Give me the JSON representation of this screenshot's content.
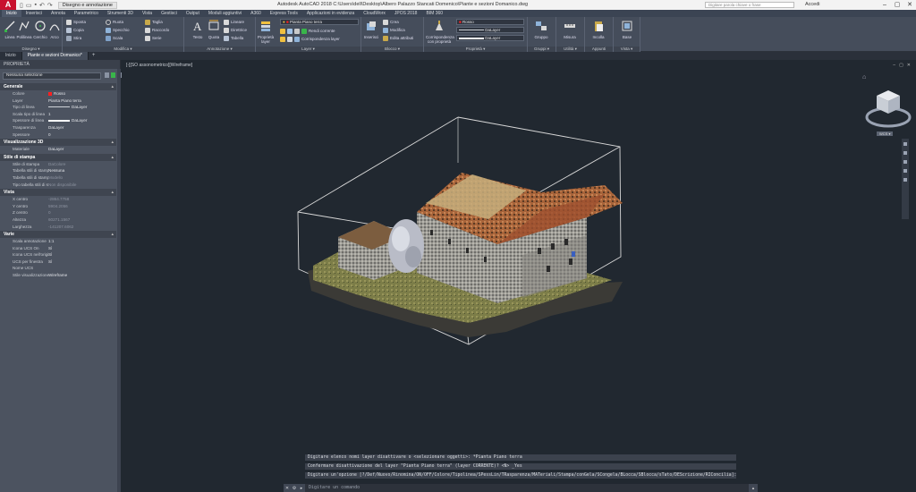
{
  "titlebar": {
    "app_logo": "A",
    "workspace": "Disegno e annotazione",
    "title": "Autodesk AutoCAD 2018    C:\\Users\\dell\\Desktop\\Albero Palazzo Stancati Domenico\\Piante e sezioni Domanico.dwg",
    "search_placeholder": "Digitare parola chiave o frase",
    "user": "Accedi"
  },
  "ribbon_tabs": [
    "Inizio",
    "Inserisci",
    "Annota",
    "Parametrico",
    "Strumenti 3D",
    "Vista",
    "Gestisci",
    "Output",
    "Moduli aggiuntivi",
    "A360",
    "Express Tools",
    "Applicazioni in evidenza",
    "CloudWorx",
    "JPOS 2018",
    "BIM 360"
  ],
  "panels": {
    "disegno": {
      "label": "Disegno ▾",
      "buttons": [
        "Linea",
        "Polilinea",
        "Cerchio",
        "Arco"
      ]
    },
    "modifica": {
      "label": "Modifica ▾",
      "rows": [
        "Sposta",
        "Ruota",
        "Taglia",
        "Copia",
        "Specchio",
        "Raccordo",
        "Stira",
        "Scala",
        "Serie"
      ]
    },
    "annotazione": {
      "label": "Annotazione ▾",
      "buttons": [
        "Testo",
        "Quota"
      ],
      "rows": [
        "Lineare",
        "Direttrice",
        "Tabella"
      ]
    },
    "layer": {
      "label": "Layer ▾",
      "button": "Proprietà layer",
      "current": "Pianta Piano terra",
      "rows": [
        "Rendi corrente",
        "Corrispondenza layer"
      ]
    },
    "blocco": {
      "label": "Blocco ▾",
      "button": "Inserisci",
      "rows": [
        "Crea",
        "Modifica",
        "Edita attributi"
      ]
    },
    "proprieta": {
      "label": "Proprietà ▾",
      "button": "Corrispondenza con proprietà",
      "color": "Rosso",
      "linetype": "DaLayer",
      "lineweight": "DaLayer"
    },
    "gruppi": {
      "label": "Gruppi ▾",
      "button": "Gruppo"
    },
    "utilita": {
      "label": "Utilità ▾",
      "button": "Misura"
    },
    "appunti": {
      "label": "Appunti",
      "button": "Incolla"
    },
    "vista": {
      "label": "Vista ▾",
      "button": "Base"
    }
  },
  "doc_tabs": [
    "Inizio",
    "Piante e sezioni Domanico*"
  ],
  "properties": {
    "title": "PROPRIETÀ",
    "selection": "Nessuna selezione",
    "groups": [
      {
        "name": "Generale",
        "rows": [
          {
            "key": "Colore",
            "value": "Rosso",
            "swatch": "#ff2020"
          },
          {
            "key": "Layer",
            "value": "Pianta Piano terra"
          },
          {
            "key": "Tipo di linea",
            "value": "DaLayer",
            "line": true
          },
          {
            "key": "Scala tipo di linea",
            "value": "1"
          },
          {
            "key": "Spessore di linea",
            "value": "DaLayer",
            "line": true,
            "thick": true
          },
          {
            "key": "Trasparenza",
            "value": "DaLayer"
          },
          {
            "key": "Spessore",
            "value": "0"
          }
        ]
      },
      {
        "name": "Visualizzazione 3D",
        "rows": [
          {
            "key": "Materiale",
            "value": "DaLayer"
          }
        ]
      },
      {
        "name": "Stile di stampa",
        "rows": [
          {
            "key": "Stile di stampa",
            "value": "DaColore",
            "dim": true
          },
          {
            "key": "Tabella stili di stampa",
            "value": "Nessuna"
          },
          {
            "key": "Tabella stili di stampa...",
            "value": "Modello",
            "dim": true
          },
          {
            "key": "Tipo tabella stili di st...",
            "value": "Non disponibile",
            "dim": true
          }
        ]
      },
      {
        "name": "Vista",
        "rows": [
          {
            "key": "X centro",
            "value": "-2864.7758",
            "dim": true
          },
          {
            "key": "Y centro",
            "value": "5904.2056",
            "dim": true
          },
          {
            "key": "Z centro",
            "value": "0",
            "dim": true
          },
          {
            "key": "Altezza",
            "value": "60271.1567",
            "dim": true
          },
          {
            "key": "Larghezza",
            "value": "-141207.6062",
            "dim": true
          }
        ]
      },
      {
        "name": "Varie",
        "rows": [
          {
            "key": "Scala annotazione",
            "value": "1:1"
          },
          {
            "key": "Icona UCS On",
            "value": "Sì"
          },
          {
            "key": "Icona UCS nell'origine",
            "value": "Sì"
          },
          {
            "key": "UCS per finestra",
            "value": "Sì"
          },
          {
            "key": "Nome UCS",
            "value": ""
          },
          {
            "key": "Stile visualizzazione",
            "value": "Wireframe"
          }
        ]
      }
    ]
  },
  "viewport": {
    "label": "[-][SO assonometrico][Wireframe]",
    "wcs": "WCS ▾",
    "viewcube_face": "SUPERIORE"
  },
  "command": {
    "history": [
      "Digitare elenco nomi layer disattivare o <selezionare oggetti>: *Pianta Piano terra",
      "Confermare disattivazione del layer \"Pianta Piano terra\" (layer CORRENTE)? <N> _Yes",
      "Digitare un'opzione [?/Def/Nuovo/Rinomina/ON/OFF/Colore/Tipolinea/SPessLin/TRasparenza/MATeriali/Stampa/conGela/SCongela/BLocca/SBlocca/sTato/DEScrizione/RIConcilia]:"
    ],
    "placeholder": "Digitare un comando"
  }
}
